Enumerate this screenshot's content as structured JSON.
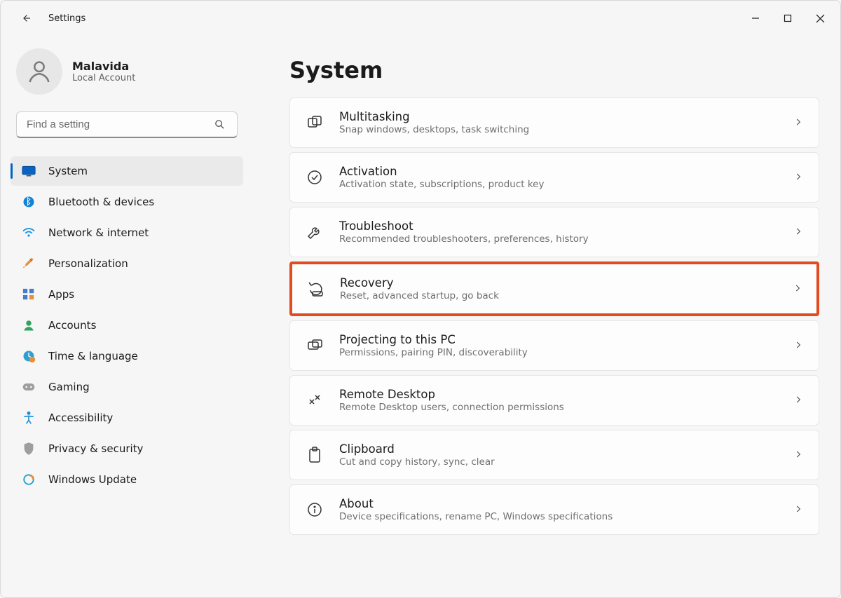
{
  "app_title": "Settings",
  "profile": {
    "name": "Malavida",
    "subtitle": "Local Account"
  },
  "search": {
    "placeholder": "Find a setting"
  },
  "page_header": "System",
  "nav": [
    {
      "label": "System",
      "active": true
    },
    {
      "label": "Bluetooth & devices"
    },
    {
      "label": "Network & internet"
    },
    {
      "label": "Personalization"
    },
    {
      "label": "Apps"
    },
    {
      "label": "Accounts"
    },
    {
      "label": "Time & language"
    },
    {
      "label": "Gaming"
    },
    {
      "label": "Accessibility"
    },
    {
      "label": "Privacy & security"
    },
    {
      "label": "Windows Update"
    }
  ],
  "cards": [
    {
      "title": "Multitasking",
      "sub": "Snap windows, desktops, task switching"
    },
    {
      "title": "Activation",
      "sub": "Activation state, subscriptions, product key"
    },
    {
      "title": "Troubleshoot",
      "sub": "Recommended troubleshooters, preferences, history"
    },
    {
      "title": "Recovery",
      "sub": "Reset, advanced startup, go back",
      "highlight": true
    },
    {
      "title": "Projecting to this PC",
      "sub": "Permissions, pairing PIN, discoverability"
    },
    {
      "title": "Remote Desktop",
      "sub": "Remote Desktop users, connection permissions"
    },
    {
      "title": "Clipboard",
      "sub": "Cut and copy history, sync, clear"
    },
    {
      "title": "About",
      "sub": "Device specifications, rename PC, Windows specifications"
    }
  ]
}
